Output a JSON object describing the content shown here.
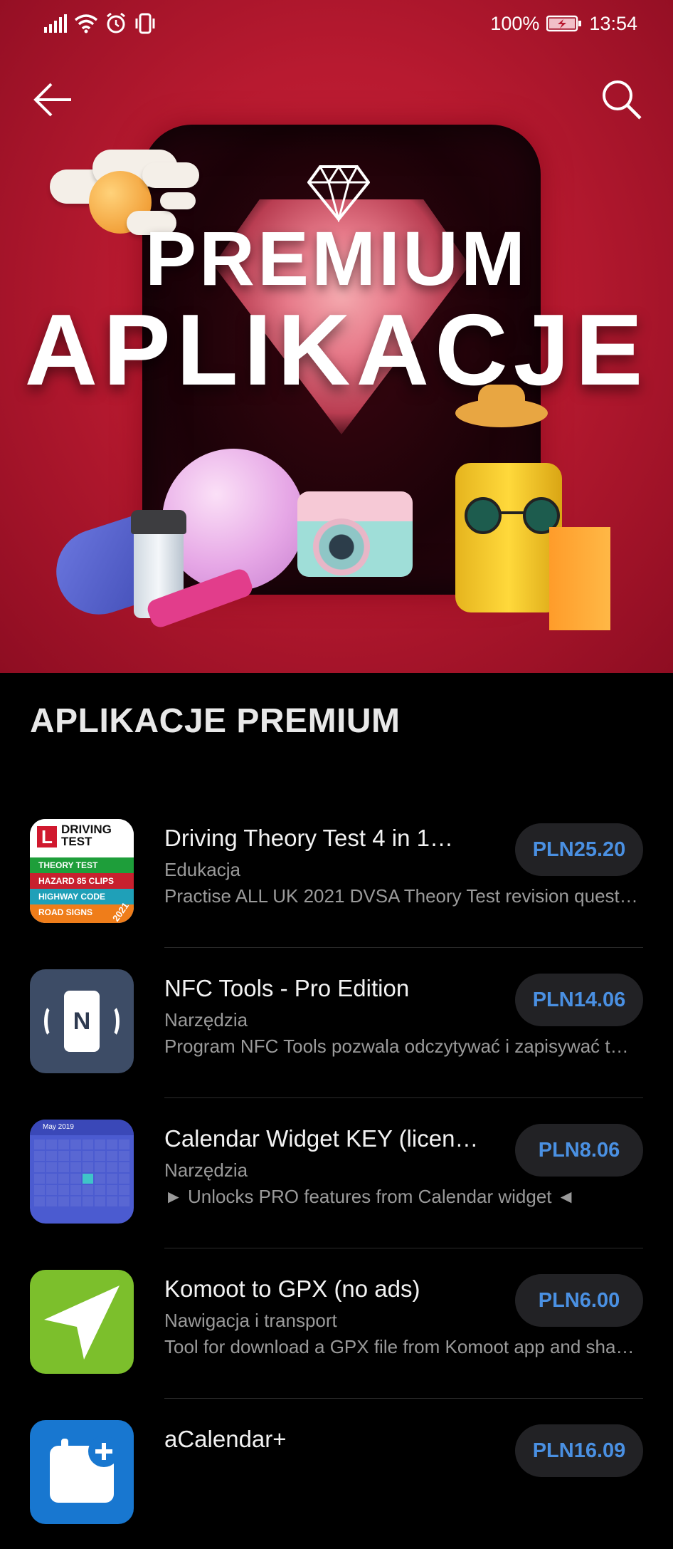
{
  "status_bar": {
    "battery": "100%",
    "time": "13:54"
  },
  "hero": {
    "title_line1": "PREMIUM",
    "title_line2": "APLIKACJE"
  },
  "section": {
    "title": "APLIKACJE PREMIUM"
  },
  "icon_texts": {
    "driving": {
      "logo_letter": "L",
      "logo_title": "DRIVING",
      "logo_title2": "TEST",
      "stripes": [
        "THEORY TEST",
        "HAZARD 85 CLIPS",
        "HIGHWAY CODE",
        "ROAD SIGNS"
      ],
      "year": "2021"
    },
    "nfc": {
      "letter": "N"
    },
    "calendar": {
      "month": "May 2019"
    }
  },
  "apps": [
    {
      "name": "Driving Theory Test 4 in 1…",
      "category": "Edukacja",
      "description": "Practise ALL UK 2021 DVSA Theory Test revision quest…",
      "price": "PLN25.20",
      "icon": "driving-test-icon"
    },
    {
      "name": "NFC Tools - Pro Edition",
      "category": "Narzędzia",
      "description": "Program NFC Tools pozwala odczytywać i zapisywać t…",
      "price": "PLN14.06",
      "icon": "nfc-tools-icon"
    },
    {
      "name": "Calendar Widget KEY (licen…",
      "category": "Narzędzia",
      "description": "► Unlocks PRO features from Calendar widget ◄",
      "price": "PLN8.06",
      "icon": "calendar-widget-icon"
    },
    {
      "name": "Komoot to GPX (no ads)",
      "category": "Nawigacja i transport",
      "description": "Tool for download a GPX file from Komoot app and sha…",
      "price": "PLN6.00",
      "icon": "navigation-arrow-icon"
    },
    {
      "name": "aCalendar+",
      "category": "",
      "description": "",
      "price": "PLN16.09",
      "icon": "acalendar-icon"
    }
  ],
  "colors": {
    "hero_red": "#b81a30",
    "price_blue": "#4a90e2",
    "background": "#000000"
  }
}
